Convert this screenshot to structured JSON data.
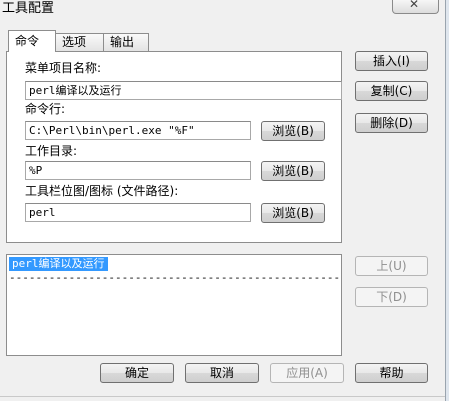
{
  "window": {
    "title": "工具配置",
    "close_glyph": "✕"
  },
  "tabs": [
    {
      "label": "命令"
    },
    {
      "label": "选项"
    },
    {
      "label": "输出"
    }
  ],
  "form": {
    "menu_name_label": "菜单项目名称:",
    "menu_name_value": "perl编译以及运行",
    "command_label": "命令行:",
    "command_value": "C:\\Perl\\bin\\perl.exe \"%F\"",
    "workdir_label": "工作目录:",
    "workdir_value": "%P",
    "icon_label": "工具栏位图/图标 (文件路径):",
    "icon_value": "perl",
    "browse_label": "浏览(B)"
  },
  "side_buttons": {
    "insert": "插入(I)",
    "copy": "复制(C)",
    "delete": "删除(D)",
    "up": "上(U)",
    "down": "下(D)"
  },
  "list": {
    "selected_item": "perl编译以及运行",
    "separator": "----------------------------------------------------------------"
  },
  "footer": {
    "ok": "确定",
    "cancel": "取消",
    "apply": "应用(A)",
    "help": "帮助"
  }
}
